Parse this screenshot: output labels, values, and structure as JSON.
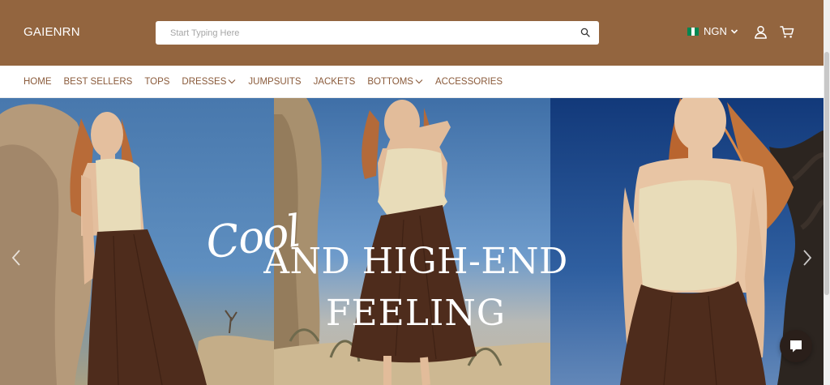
{
  "brand": {
    "logo_text": "GAIENRN"
  },
  "search": {
    "placeholder": "Start Typing Here",
    "value": ""
  },
  "header": {
    "currency": "NGN",
    "flag_colors": [
      "#008751",
      "#ffffff",
      "#008751"
    ],
    "icons": [
      "search-icon",
      "user-icon",
      "cart-icon",
      "chevron-down-icon"
    ]
  },
  "nav": {
    "items": [
      {
        "label": "HOME",
        "has_dropdown": false
      },
      {
        "label": "BEST SELLERS",
        "has_dropdown": false
      },
      {
        "label": "TOPS",
        "has_dropdown": false
      },
      {
        "label": "DRESSES",
        "has_dropdown": true
      },
      {
        "label": "JUMPSUITS",
        "has_dropdown": false
      },
      {
        "label": "JACKETS",
        "has_dropdown": false
      },
      {
        "label": "BOTTOMS",
        "has_dropdown": true
      },
      {
        "label": "ACCESSORIES",
        "has_dropdown": false
      }
    ]
  },
  "hero": {
    "script_text": "Cool",
    "headline_line1": "AND HIGH-END",
    "headline_line2": "FEELING",
    "icons": [
      "chevron-left-icon",
      "chevron-right-icon"
    ]
  },
  "chat": {
    "icon": "chat-icon"
  },
  "colors": {
    "header_bg": "#93653f",
    "nav_text": "#8a5a3a",
    "chat_bg": "#2a1f1a",
    "skirt_brown": "#4e2c1c",
    "top_cream": "#e8dcb9"
  }
}
